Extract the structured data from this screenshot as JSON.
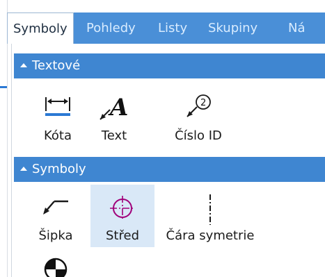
{
  "tabs": [
    {
      "label": "Symboly",
      "active": true
    },
    {
      "label": "Pohledy",
      "active": false
    },
    {
      "label": "Listy",
      "active": false
    },
    {
      "label": "Skupiny",
      "active": false
    },
    {
      "label": "Ná",
      "active": false
    }
  ],
  "sections": {
    "textove": {
      "title": "Textové",
      "items": [
        {
          "label": "Kóta",
          "icon": "dimension-icon"
        },
        {
          "label": "Text",
          "icon": "text-a-icon"
        },
        {
          "label": "Číslo ID",
          "icon": "callout-id-icon"
        }
      ]
    },
    "symboly": {
      "title": "Symboly",
      "items": [
        {
          "label": "Šipka",
          "icon": "leader-arrow-icon"
        },
        {
          "label": "Střed",
          "icon": "center-mark-icon",
          "selected": true
        },
        {
          "label": "Čára symetrie",
          "icon": "symmetry-line-icon"
        },
        {
          "label": "",
          "icon": "cut-symbol-icon"
        }
      ]
    }
  },
  "colors": {
    "tabbar": "#4a8fd7",
    "tab_inactive_text": "#d9ecff",
    "section_header": "#3f86d1",
    "selected_bg": "#d9e8f7",
    "center_mark": "#a0007a",
    "dimension_accent": "#2b79d4"
  }
}
